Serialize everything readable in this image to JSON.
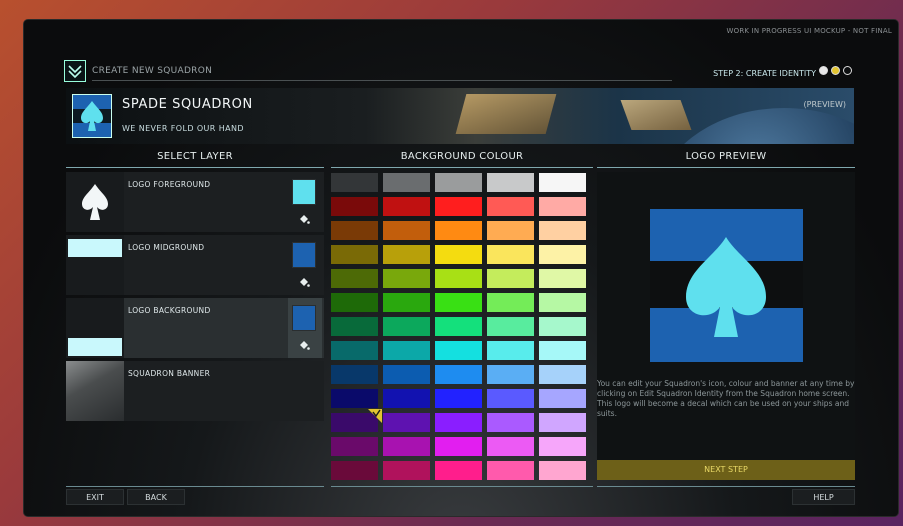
{
  "watermark": "WORK IN PROGRESS UI MOCKUP - NOT FINAL",
  "header": {
    "title": "CREATE NEW SQUADRON",
    "step": "STEP 2: CREATE IDENTITY",
    "step_dots": [
      "#e8e8e8",
      "#e2c431",
      "#0d0f10"
    ]
  },
  "banner": {
    "name": "SPADE SQUADRON",
    "motto": "WE NEVER FOLD OUR HAND",
    "preview_label": "(PREVIEW)"
  },
  "columns": {
    "left": "SELECT LAYER",
    "middle": "BACKGROUND COLOUR",
    "right": "LOGO PREVIEW"
  },
  "layers": [
    {
      "label": "LOGO FOREGROUND",
      "swatch": "#5fe0ee",
      "thumb": "spade",
      "selected": false
    },
    {
      "label": "LOGO MIDGROUND",
      "swatch": "#1d62b0",
      "thumb": "top-bar",
      "selected": false
    },
    {
      "label": "LOGO BACKGROUND",
      "swatch": "#1d62b0",
      "thumb": "bottom-bar",
      "selected": true
    },
    {
      "label": "SQUADRON BANNER",
      "swatch": "",
      "thumb": "banner",
      "selected": false
    }
  ],
  "palette": [
    [
      "#333638",
      "#6a6d6f",
      "#9a9c9d",
      "#c8c9ca",
      "#f6f6f6"
    ],
    [
      "#7a0a0a",
      "#c01111",
      "#ff1e1e",
      "#ff5a55",
      "#ffaaa5"
    ],
    [
      "#7a3a06",
      "#c25e0c",
      "#ff8a12",
      "#ffab52",
      "#ffd0a2"
    ],
    [
      "#7a6a06",
      "#b8a00a",
      "#f4dc10",
      "#fae55c",
      "#fdf2a6"
    ],
    [
      "#4d6a06",
      "#79a80c",
      "#a8e015",
      "#c4ec5c",
      "#e0f8a6"
    ],
    [
      "#1e6a08",
      "#2aa80e",
      "#39e014",
      "#74ec58",
      "#b6f8a4"
    ],
    [
      "#086a3a",
      "#0ca85c",
      "#14e07c",
      "#58ec9e",
      "#a6f8cc"
    ],
    [
      "#086a6a",
      "#0ca8a8",
      "#14e0e0",
      "#58ecec",
      "#a6f8f8"
    ],
    [
      "#08386a",
      "#0c5cb0",
      "#1e8cf0",
      "#5aaef4",
      "#a6d2fa"
    ],
    [
      "#0a0a6a",
      "#1212b0",
      "#2222ff",
      "#5a5aff",
      "#a6a6ff"
    ],
    [
      "#3a0a6a",
      "#5e12b0",
      "#8a1eff",
      "#aa5aff",
      "#d0a6ff"
    ],
    [
      "#6a0a6a",
      "#a812b0",
      "#e21ef0",
      "#ec5af4",
      "#f6a6fa"
    ],
    [
      "#6a0a3a",
      "#b0125c",
      "#ff1e8c",
      "#ff5aac",
      "#ffa6d0"
    ]
  ],
  "selected_swatch": {
    "row": 10,
    "col": 0
  },
  "preview": {
    "background": "#1d62b0",
    "midground": "#0d0f10",
    "foreground": "#5fe0ee",
    "description": "You can edit your Squadron's icon, colour and banner at any time by clicking on Edit Squadron Identity from the Squadron home screen. This logo will become a decal which can be used on your ships and suits."
  },
  "buttons": {
    "next": "NEXT STEP",
    "exit": "EXIT",
    "back": "BACK",
    "help": "HELP"
  }
}
